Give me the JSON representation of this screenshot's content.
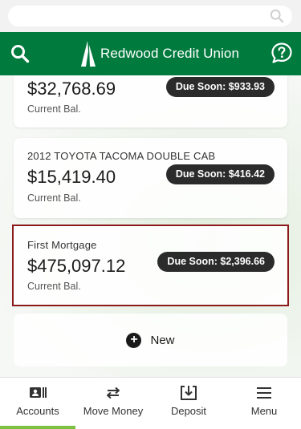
{
  "header": {
    "brand": "Redwood Credit Union"
  },
  "accounts": [
    {
      "name": "",
      "balance": "$32,768.69",
      "balance_label": "Current Bal.",
      "due": "Due Soon: $933.93"
    },
    {
      "name": "2012 TOYOTA TACOMA DOUBLE CAB",
      "balance": "$15,419.40",
      "balance_label": "Current Bal.",
      "due": "Due Soon: $416.42"
    },
    {
      "name": "First Mortgage",
      "balance": "$475,097.12",
      "balance_label": "Current Bal.",
      "due": "Due Soon: $2,396.66"
    }
  ],
  "new_account": {
    "label": "New"
  },
  "nav": {
    "items": [
      {
        "label": "Accounts",
        "icon": "accounts-icon",
        "active": true
      },
      {
        "label": "Move Money",
        "icon": "transfer-arrows-icon",
        "active": false
      },
      {
        "label": "Deposit",
        "icon": "deposit-icon",
        "active": false
      },
      {
        "label": "Menu",
        "icon": "hamburger-menu-icon",
        "active": false
      }
    ]
  },
  "colors": {
    "brand_green": "#007a3d",
    "active_tab_indicator": "#7cc13f",
    "due_pill": "#2b2b2b",
    "highlight_outline": "#8b1a1a"
  }
}
